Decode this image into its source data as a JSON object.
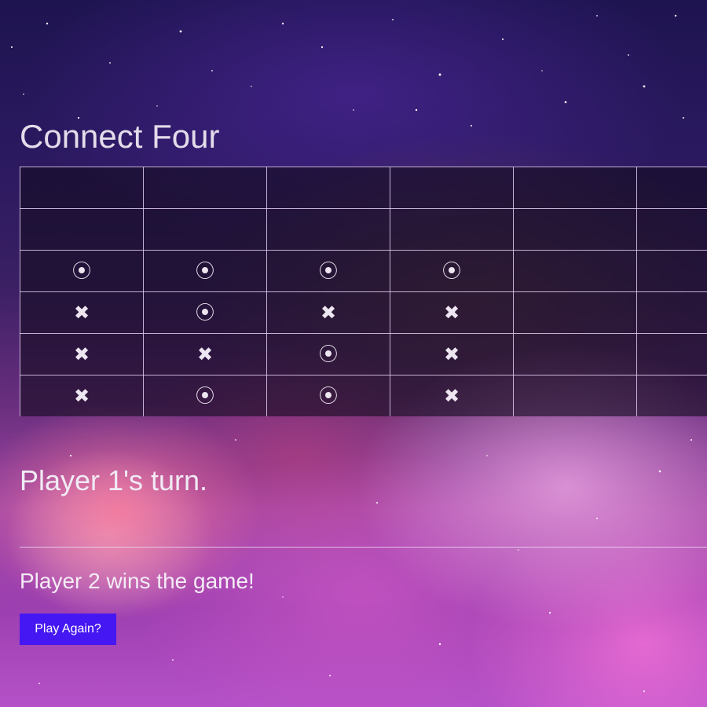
{
  "game": {
    "title": "Connect Four",
    "turn_text": "Player 1's turn.",
    "result_text": "Player 2 wins the game!",
    "play_again_label": "Play Again?"
  },
  "board": {
    "columns_visible": 6,
    "cells": [
      [
        "",
        "",
        "",
        "",
        "",
        ""
      ],
      [
        "",
        "",
        "",
        "",
        "",
        ""
      ],
      [
        "O",
        "O",
        "O",
        "O",
        "",
        ""
      ],
      [
        "X",
        "O",
        "X",
        "X",
        "",
        ""
      ],
      [
        "X",
        "X",
        "O",
        "X",
        "",
        ""
      ],
      [
        "X",
        "O",
        "O",
        "X",
        "",
        ""
      ]
    ],
    "symbols": {
      "O": "⦿",
      "X": "✖"
    }
  },
  "colors": {
    "button": "#4517f2",
    "text": "#e3dcea",
    "grid_line": "#e1cdf0"
  },
  "icons": {
    "O": "player-2-ring-icon",
    "X": "player-1-cross-icon"
  }
}
